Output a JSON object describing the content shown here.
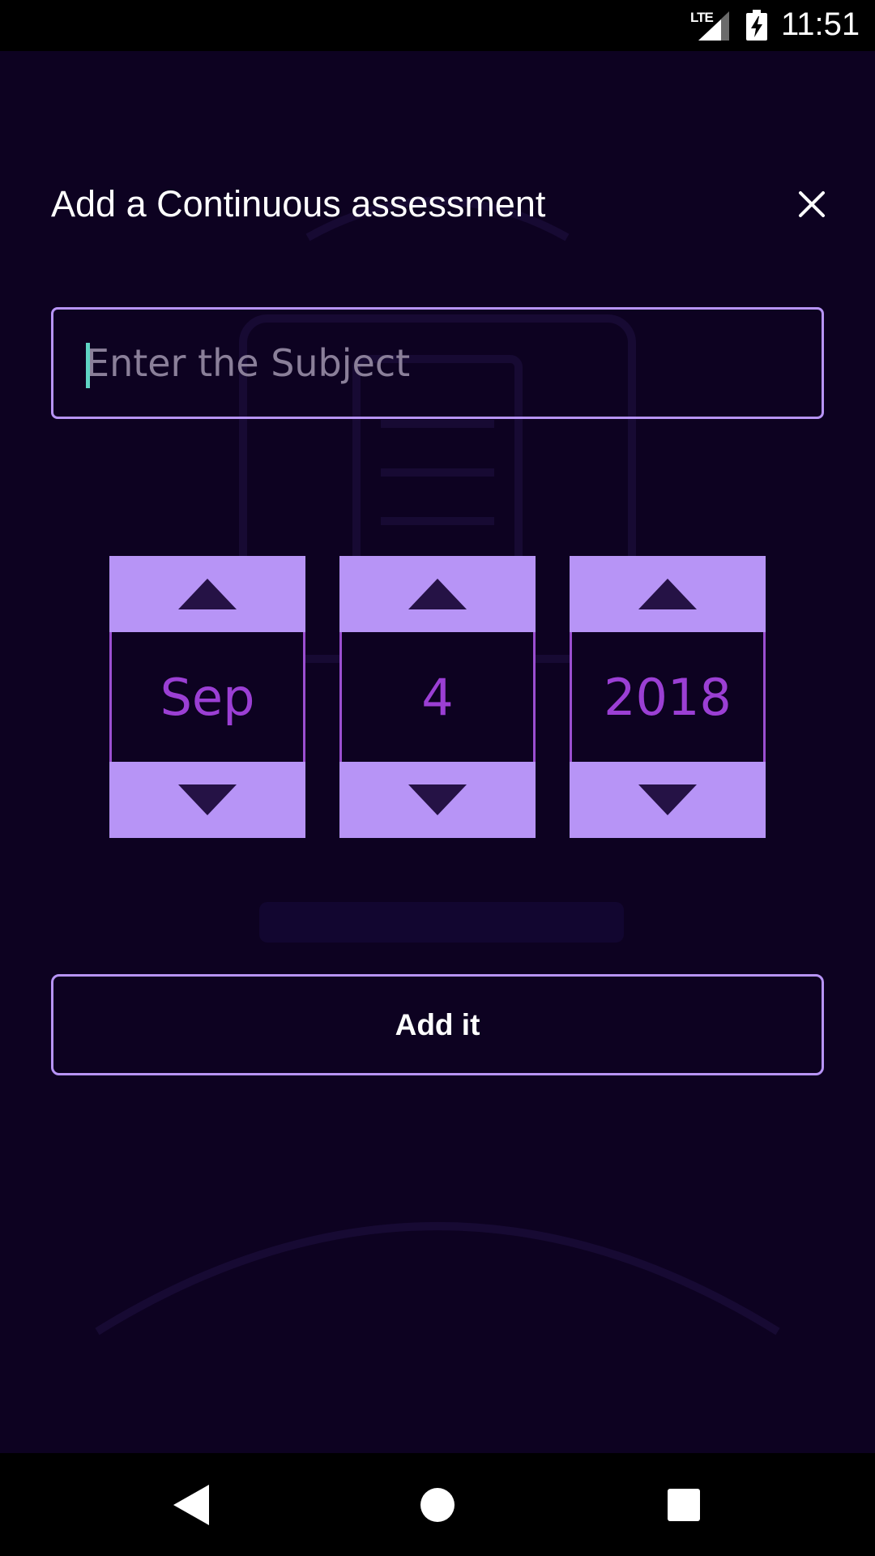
{
  "status_bar": {
    "network": "LTE",
    "time": "11:51"
  },
  "dialog": {
    "title": "Add a Continuous assessment",
    "close_icon": "close-icon"
  },
  "subject": {
    "placeholder": "Enter the Subject",
    "value": ""
  },
  "date_picker": {
    "month": "Sep",
    "day": "4",
    "year": "2018"
  },
  "actions": {
    "add_label": "Add it"
  },
  "colors": {
    "background": "#0d0221",
    "accent": "#b794f6",
    "picker_value": "#9b3fd4",
    "caret": "#5fd4c4"
  }
}
